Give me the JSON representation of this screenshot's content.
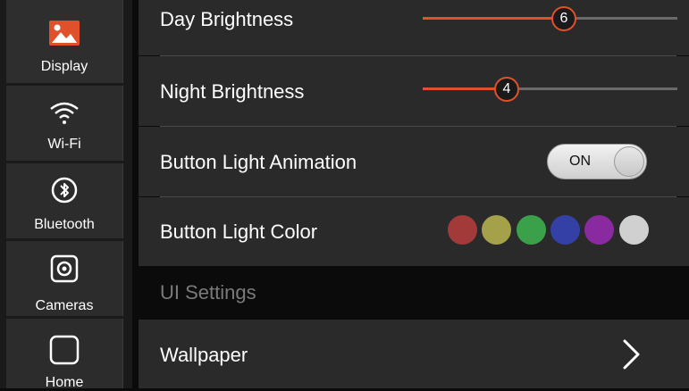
{
  "sidebar": {
    "items": [
      {
        "label": "Display",
        "icon": "image-icon"
      },
      {
        "label": "Wi-Fi",
        "icon": "wifi-icon"
      },
      {
        "label": "Bluetooth",
        "icon": "bluetooth-icon"
      },
      {
        "label": "Cameras",
        "icon": "camera-icon"
      },
      {
        "label": "Home",
        "icon": "home-square-icon"
      }
    ],
    "accent_color": "#e0502a"
  },
  "settings": {
    "day_brightness": {
      "label": "Day Brightness",
      "value": "6"
    },
    "night_brightness": {
      "label": "Night Brightness",
      "value": "4"
    },
    "button_light_animation": {
      "label": "Button Light Animation",
      "state": "ON"
    },
    "button_light_color": {
      "label": "Button Light Color",
      "colors": [
        "#a23a3a",
        "#a5a04a",
        "#3aa14a",
        "#3440a5",
        "#8a2aa0",
        "#d0d0d0"
      ]
    },
    "ui_settings_header": "UI Settings",
    "wallpaper": {
      "label": "Wallpaper"
    }
  }
}
